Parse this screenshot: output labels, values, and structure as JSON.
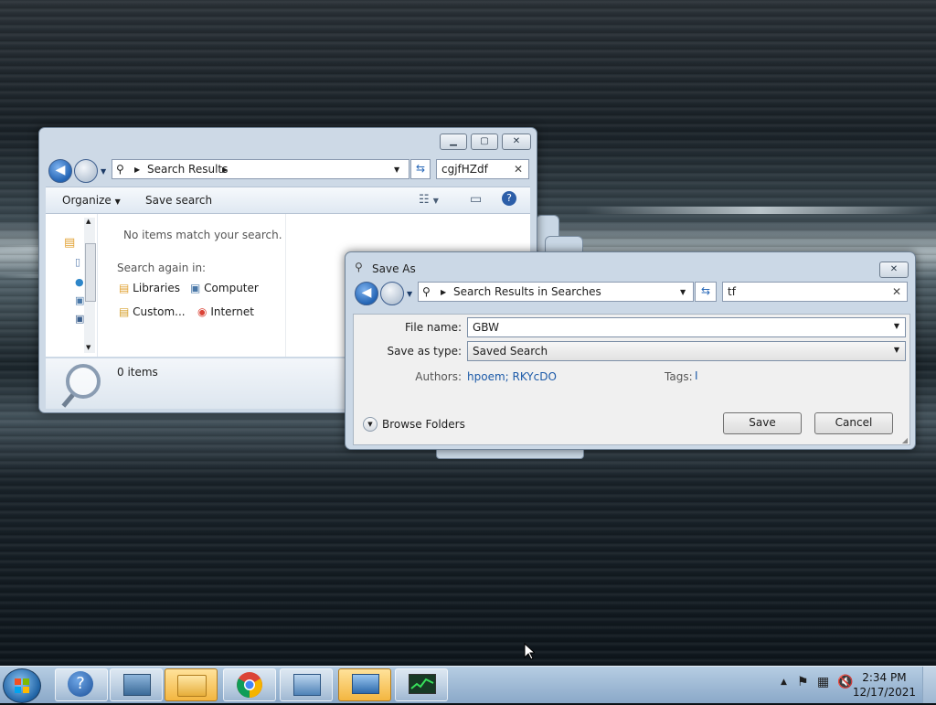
{
  "explorer": {
    "address": "Search Results",
    "search_value": "cgjfHZdf",
    "organize_label": "Organize",
    "save_search_label": "Save search",
    "empty_message": "No items match your search.",
    "search_again_label": "Search again in:",
    "search_again_items": [
      "Libraries",
      "Computer",
      "Custom...",
      "Internet"
    ],
    "status_items": "0 items"
  },
  "saveas": {
    "title": "Save As",
    "address": "Search Results in Searches",
    "search_value": "tf",
    "file_name_label": "File name:",
    "file_name_value": "GBW",
    "save_type_label": "Save as type:",
    "save_type_value": "Saved Search",
    "authors_label": "Authors:",
    "authors_value": "hpoem; RKYcDO",
    "tags_label": "Tags:",
    "browse_folders_label": "Browse Folders",
    "save_label": "Save",
    "cancel_label": "Cancel"
  },
  "taskbar": {
    "time": "2:34 PM",
    "date": "12/17/2021"
  },
  "icons": {
    "back": "back-arrow-icon",
    "search": "magnifier-icon",
    "refresh": "refresh-icon",
    "help": "help-icon"
  }
}
